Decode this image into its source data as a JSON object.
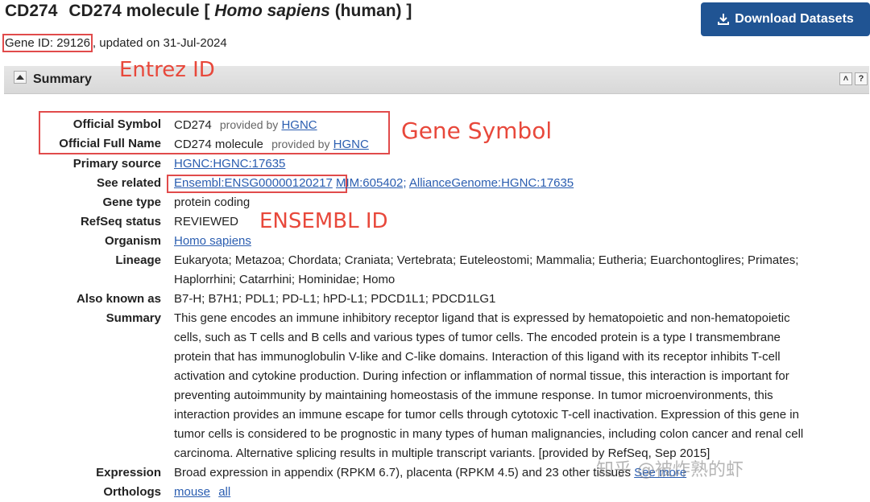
{
  "header": {
    "symbol": "CD274",
    "title_prefix": "CD274 molecule [",
    "title_species": "Homo sapiens",
    "title_suffix": "(human) ]",
    "gene_id": "Gene ID: 29126",
    "updated": ", updated on 31-Jul-2024"
  },
  "download_button": {
    "label": "Download Datasets",
    "icon": "download-icon"
  },
  "section": {
    "title": "Summary",
    "collapse_icon": "triangle-up-icon",
    "icons": [
      "double-chevron-up-icon",
      "help-icon"
    ]
  },
  "annotations": {
    "entrez": "Entrez ID",
    "symbol": "Gene Symbol",
    "ensembl": "ENSEMBL ID"
  },
  "fields": {
    "official_symbol": {
      "label": "Official Symbol",
      "value": "CD274",
      "provided_by": "provided by",
      "source": "HGNC"
    },
    "official_full_name": {
      "label": "Official Full Name",
      "value": "CD274 molecule",
      "provided_by": "provided by",
      "source": "HGNC"
    },
    "primary_source": {
      "label": "Primary source",
      "link": "HGNC:HGNC:17635"
    },
    "see_related": {
      "label": "See related",
      "links": [
        "Ensembl:ENSG00000120217",
        "MIM:605402;",
        "AllianceGenome:HGNC:17635"
      ]
    },
    "gene_type": {
      "label": "Gene type",
      "value": "protein coding"
    },
    "refseq_status": {
      "label": "RefSeq status",
      "value": "REVIEWED"
    },
    "organism": {
      "label": "Organism",
      "link": "Homo sapiens"
    },
    "lineage": {
      "label": "Lineage",
      "line1": "Eukaryota; Metazoa; Chordata; Craniata; Vertebrata; Euteleostomi; Mammalia; Eutheria; Euarchontoglires; Primates;",
      "line2": "Haplorrhini; Catarrhini; Hominidae; Homo"
    },
    "also_known_as": {
      "label": "Also known as",
      "value": "B7-H; B7H1; PDL1; PD-L1; hPD-L1; PDCD1L1; PDCD1LG1"
    },
    "summary": {
      "label": "Summary",
      "lines": [
        "This gene encodes an immune inhibitory receptor ligand that is expressed by hematopoietic and non-hematopoietic",
        "cells, such as T cells and B cells and various types of tumor cells. The encoded protein is a type I transmembrane",
        "protein that has immunoglobulin V-like and C-like domains. Interaction of this ligand with its receptor inhibits T-cell",
        "activation and cytokine production. During infection or inflammation of normal tissue, this interaction is important for",
        "preventing autoimmunity by maintaining homeostasis of the immune response. In tumor microenvironments, this",
        "interaction provides an immune escape for tumor cells through cytotoxic T-cell inactivation. Expression of this gene in",
        "tumor cells is considered to be prognostic in many types of human malignancies, including colon cancer and renal cell",
        "carcinoma. Alternative splicing results in multiple transcript variants. [provided by RefSeq, Sep 2015]"
      ]
    },
    "expression": {
      "label": "Expression",
      "value": "Broad expression in appendix (RPKM 6.7), placenta (RPKM 4.5) and 23 other tissues",
      "link": "See more"
    },
    "orthologs": {
      "label": "Orthologs",
      "links": [
        "mouse",
        "all"
      ]
    }
  },
  "watermark": "知乎 @被炸熟的虾"
}
